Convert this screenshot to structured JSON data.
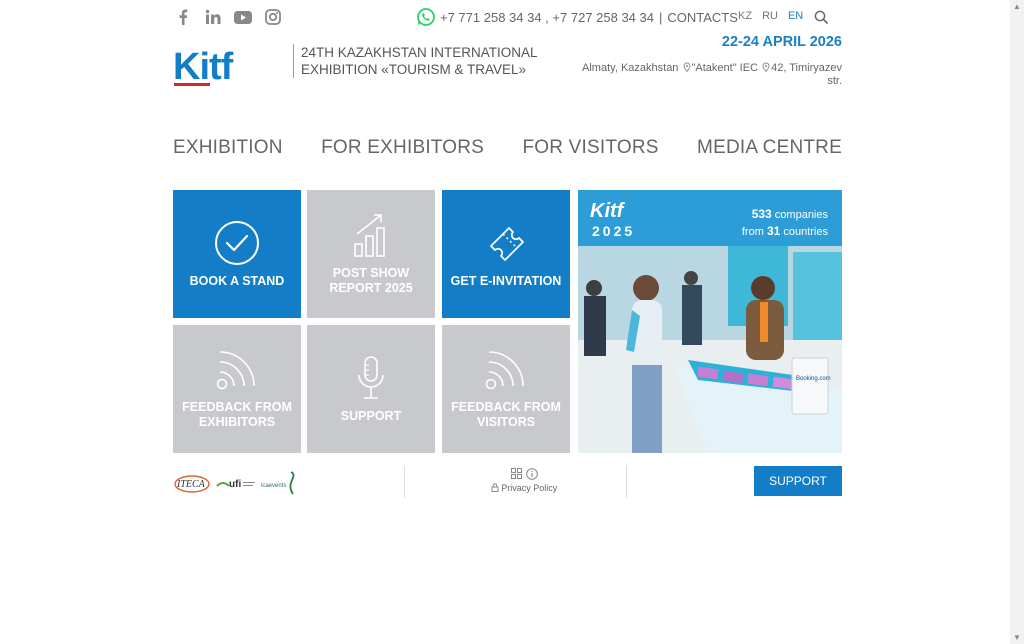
{
  "top": {
    "phones": "+7 771 258 34 34 , +7 727 258 34 34",
    "separator": "|",
    "contacts_label": "CONTACTS",
    "languages": [
      "KZ",
      "RU",
      "EN"
    ],
    "active_language": "EN"
  },
  "header": {
    "logo_text": "Kitf",
    "tagline_line1": "24TH KAZAKHSTAN INTERNATIONAL",
    "tagline_line2": "EXHIBITION «TOURISM & TRAVEL»",
    "dates": "22-24 APRIL 2026",
    "address_city": "Almaty, Kazakhstan",
    "address_venue": "\"Atakent\" IEC",
    "address_street": "42, Timiryazev str."
  },
  "nav": [
    "EXHIBITION",
    "FOR EXHIBITORS",
    "FOR VISITORS",
    "MEDIA CENTRE"
  ],
  "tiles": {
    "book": "BOOK A STAND",
    "report": "POST SHOW REPORT 2025",
    "invite": "GET E-INVITATION",
    "feedback_exhibitors": "FEEDBACK FROM EXHIBITORS",
    "support": "SUPPORT",
    "feedback_visitors": "FEEDBACK FROM VISITORS"
  },
  "promo": {
    "logo": "Kitf",
    "year": "2025",
    "companies_count": "533",
    "companies_label": "companies",
    "countries_prefix": "from",
    "countries_count": "31",
    "countries_label": "countries",
    "sign": "Booking.com"
  },
  "footer": {
    "partner1": "ITECA",
    "partner2": "ufi",
    "partner3": "icaevents",
    "privacy_label": "Privacy Policy",
    "support_button": "SUPPORT"
  },
  "colors": {
    "accent": "#137ec7",
    "tile_gray": "#c8c9cc",
    "whatsapp": "#25d366"
  }
}
